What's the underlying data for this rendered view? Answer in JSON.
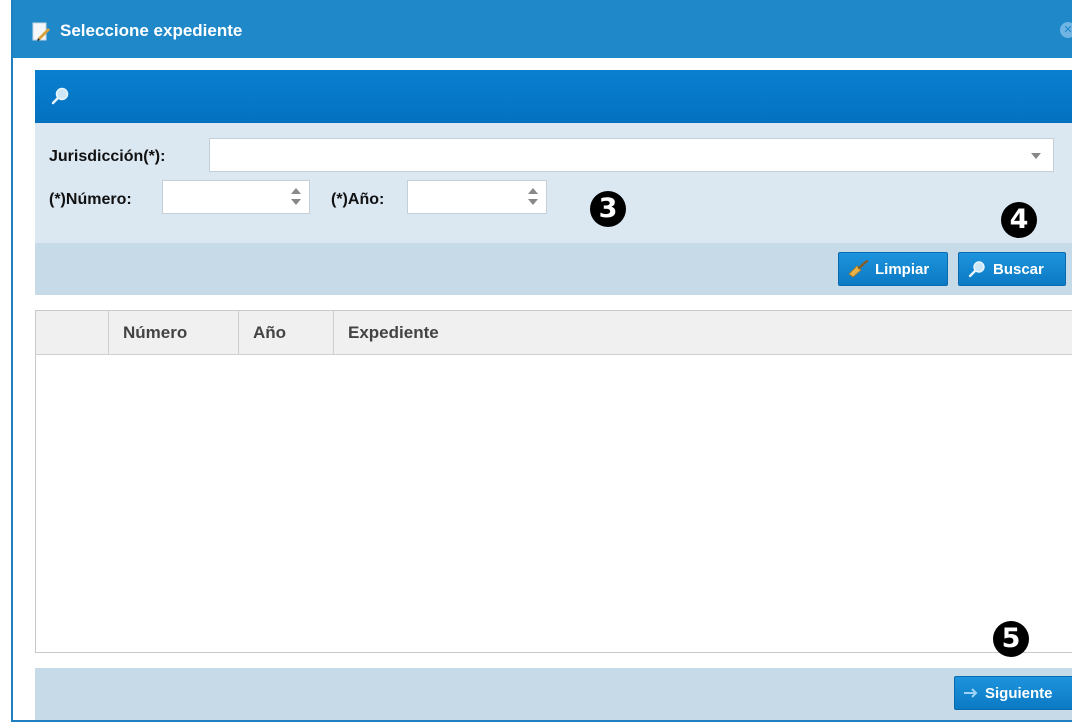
{
  "window": {
    "title": "Seleccione expediente",
    "close_glyph": "✕"
  },
  "search": {
    "jurisdiccion_label": "Jurisdicción(*):",
    "jurisdiccion_value": "",
    "numero_label": "(*)Número:",
    "numero_value": "",
    "anio_label": "(*)Año:",
    "anio_value": ""
  },
  "buttons": {
    "limpiar": "Limpiar",
    "buscar": "Buscar",
    "siguiente": "Siguiente"
  },
  "table": {
    "columns": [
      "",
      "Número",
      "Año",
      "Expediente"
    ],
    "rows": []
  },
  "markers": {
    "m3": "3",
    "m4": "4",
    "m5": "5"
  },
  "icons": {
    "title": "document-edit-icon",
    "search_header": "magnifier-icon",
    "limpiar": "broom-icon",
    "buscar": "magnifier-icon",
    "siguiente": "arrow-right-icon"
  },
  "colors": {
    "titlebar": "#1e88c9",
    "search_header": "#0a7fd0",
    "button": "#1d94dd",
    "form_bg": "#dbe8f2",
    "bar_bg": "#c7dae8"
  }
}
